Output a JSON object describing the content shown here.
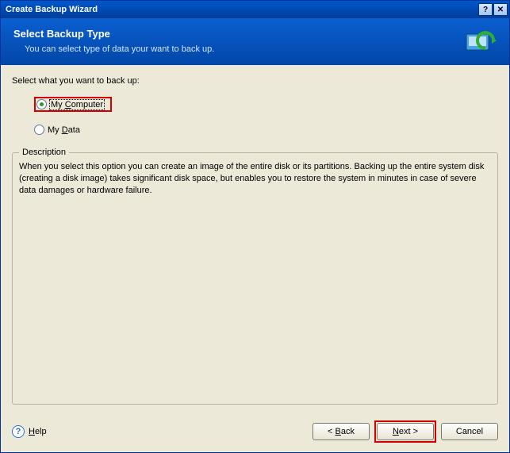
{
  "titlebar": {
    "title": "Create Backup Wizard"
  },
  "banner": {
    "heading": "Select Backup Type",
    "subtext": "You can select type of data your want to back up."
  },
  "content": {
    "prompt": "Select what you want to back up:",
    "options": {
      "my_computer": "My Computer",
      "my_data": "My Data"
    }
  },
  "description": {
    "legend": "Description",
    "text": "When you select this option you can create an image of the entire disk or its partitions. Backing up the entire system disk (creating a disk image) takes significant disk space, but enables you to restore the system in minutes in case of severe data damages or hardware failure."
  },
  "footer": {
    "help": "Help",
    "back": "< Back",
    "next": "Next >",
    "cancel": "Cancel"
  }
}
